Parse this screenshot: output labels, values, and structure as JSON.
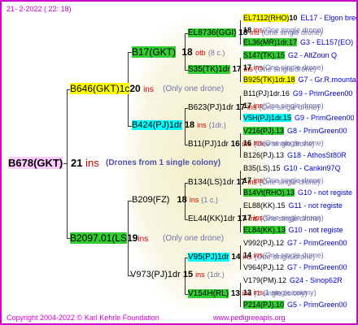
{
  "header": "21-  2-2022 ( 22: 18)",
  "root": {
    "id": "B678(GKT)",
    "ins": "21",
    "ins_label": "ins",
    "note": "(Drones from 1 single colony)"
  },
  "gen1": {
    "upper": {
      "id": "B646(GKT)1c",
      "ins": "20",
      "ins_label": "ins",
      "note": "(Only one drone)"
    },
    "lower": {
      "id": "B2097.01(LS",
      "ins": "19",
      "ins_label": "ins",
      "note": "(Only one drone)"
    }
  },
  "gen2": [
    {
      "id": "B17(GKT)",
      "ins": "18",
      "ins_label": "otb",
      "note": "(8 c.)"
    },
    {
      "id": "B424(PJ)1dr",
      "ins": "18",
      "ins_label": "ins",
      "note": "(1dr.)"
    },
    {
      "id": "B209(FZ)",
      "ins": "18",
      "ins_label": "ins",
      "note": "(1 c.)"
    },
    {
      "id": "V973(PJ)1dr",
      "ins": "15",
      "ins_label": "ins",
      "note": "(1dr.)"
    }
  ],
  "gen3": [
    {
      "id": "EL8736(GGI)",
      "ins": "18",
      "ins_label": "ins",
      "note": "(One single drone)"
    },
    {
      "id": "S35(TK)1dr",
      "ins": "17",
      "ins_label": "ins",
      "note": "(One single drone)"
    },
    {
      "id": "B623(PJ)1dr",
      "ins": "17",
      "ins_label": "ins",
      "note": "(One single drone)"
    },
    {
      "id": "B11(PJ)1dr",
      "ins": "16",
      "ins_label": "ins",
      "note": "(One single drone)"
    },
    {
      "id": "B134(LS)1dr",
      "ins": "17",
      "ins_label": "ins",
      "note": "(One single drone)"
    },
    {
      "id": "EL44(KK)1dr",
      "ins": "17",
      "ins_label": "ins",
      "note": "(One single drone)"
    },
    {
      "id": "V95(PJ)1dr",
      "ins": "14",
      "ins_label": "ins",
      "note": "(One single drone)"
    },
    {
      "id": "V154H(RL)",
      "ins": "13",
      "ins_label": "ins",
      "note": "(1 single colony)"
    }
  ],
  "gen4": [
    {
      "id": "EL7112(RHO)",
      "hl": "y",
      "extra": "10",
      "note": "EL17 - Elgon breed"
    },
    {
      "id": "EL36(MR)1dr.17",
      "hl": "g",
      "extra": "",
      "note": "G3 - EL157(EO)"
    },
    {
      "id": "S147(TK).15",
      "hl": "g",
      "extra": "",
      "note": "G2 - AltZoun Q"
    },
    {
      "id": "B925(TK)1dr.18",
      "hl": "y",
      "extra": "",
      "note": "G7 - Gr.R.mounta"
    },
    {
      "id": "B11(PJ)1dr.16",
      "hl": "",
      "extra": "",
      "note": "G9 - PrimGreen00"
    },
    {
      "id": "V5H(PJ)1dr.15",
      "hl": "c",
      "extra": "",
      "note": "G9 - PrimGreen00"
    },
    {
      "id": "V216(PJ).13",
      "hl": "g",
      "extra": "",
      "note": "G8 - PrimGreen00"
    },
    {
      "id": "B126(PJ).13",
      "hl": "",
      "extra": "",
      "note": "G18 - AthosSt80R"
    },
    {
      "id": "B35(LS).15",
      "hl": "",
      "extra": "",
      "note": "G10 - Cankiri97Q"
    },
    {
      "id": "B14Vt(RHO).13",
      "hl": "g",
      "extra": "",
      "note": "G10 - not registe"
    },
    {
      "id": "EL88(KK).15",
      "hl": "",
      "extra": "",
      "note": "G11 - not registe"
    },
    {
      "id": "EL84(KK).13",
      "hl": "g",
      "extra": "",
      "note": "G10 - not registe"
    },
    {
      "id": "V992(PJ).12",
      "hl": "",
      "extra": "",
      "note": "G7 - PrimGreen00"
    },
    {
      "id": "V964(PJ).12",
      "hl": "",
      "extra": "",
      "note": "G7 - PrimGreen00"
    },
    {
      "id": "V179(PM).12",
      "hl": "",
      "extra": "",
      "note": "G24 - Sinop62R"
    },
    {
      "id": "P214(PJ).10",
      "hl": "g",
      "extra": "",
      "note": "G5 - PrimGreen00"
    }
  ],
  "gen4_sub": [
    {
      "ins": "18",
      "ins_label": "ins",
      "note": "(One single drone)"
    },
    {
      "ins": "17",
      "ins_label": "ins",
      "note": "(One single drone)"
    },
    {
      "ins": "17",
      "ins_label": "ins",
      "note": "(One single drone)"
    },
    {
      "ins": "16",
      "ins_label": "ins",
      "note": "(One single drone)"
    },
    {
      "ins": "17",
      "ins_label": "ins",
      "note": "(One single drone)"
    },
    {
      "ins": "17",
      "ins_label": "ins",
      "note": "(One single drone)"
    },
    {
      "ins": "14",
      "ins_label": "ins",
      "note": "(One single drone)"
    },
    {
      "ins": "13",
      "ins_label": "ins",
      "note": "(1 single colony)"
    }
  ],
  "footer": {
    "copyright": "Copyright 2004-2022 © Karl Kehrle Foundation",
    "url": "www.pedigreeapis.org"
  }
}
